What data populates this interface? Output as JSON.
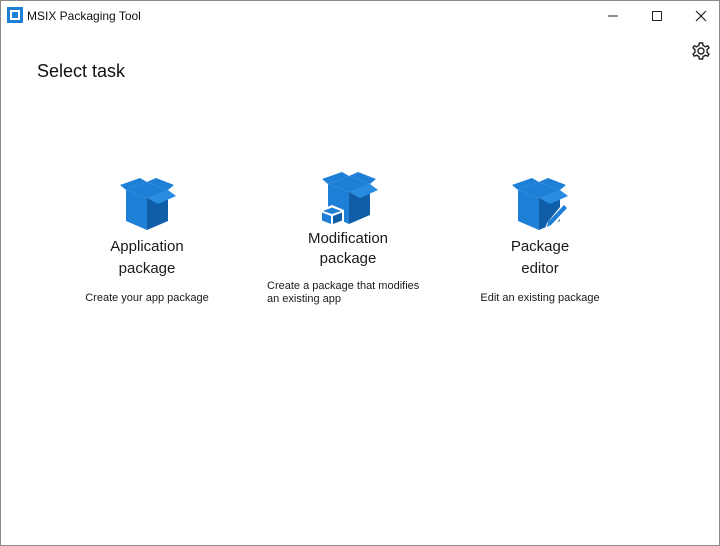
{
  "window": {
    "title": "MSIX Packaging Tool"
  },
  "page": {
    "title": "Select task"
  },
  "tasks": [
    {
      "title_line1": "Application",
      "title_line2": "package",
      "description": "Create your app package",
      "icon": "package-box-icon"
    },
    {
      "title_line1": "Modification",
      "title_line2": "package",
      "description": "Create a package that modifies an existing app",
      "icon": "modification-package-icon"
    },
    {
      "title_line1": "Package",
      "title_line2": "editor",
      "description": "Edit an existing package",
      "icon": "package-editor-icon"
    }
  ],
  "colors": {
    "accent": "#1e7fd6",
    "accent_dark": "#115ea8"
  }
}
